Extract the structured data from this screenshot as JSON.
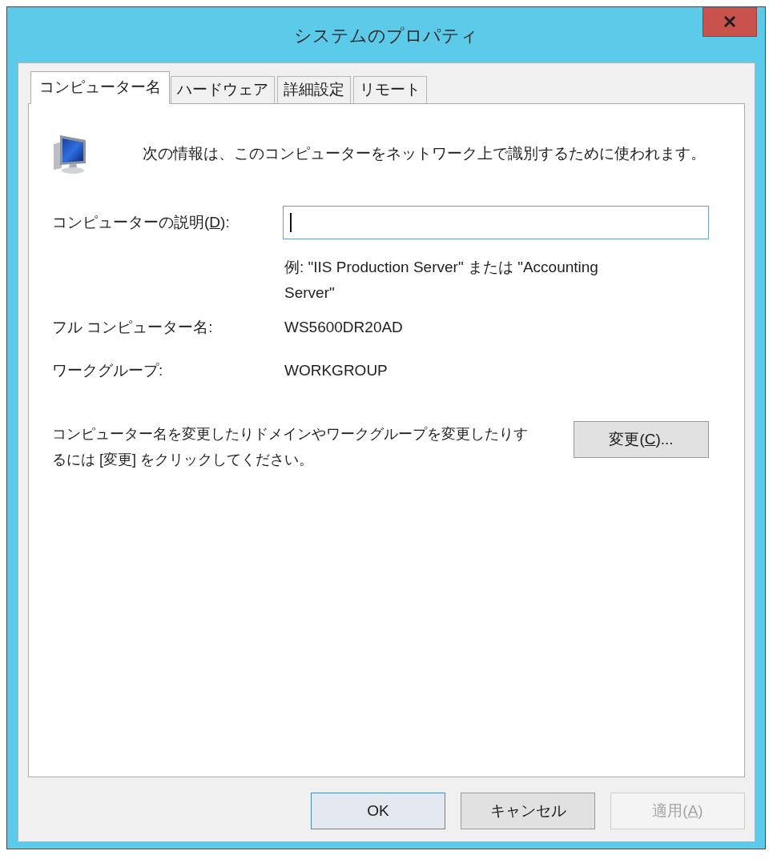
{
  "window": {
    "title": "システムのプロパティ"
  },
  "tabs": [
    {
      "label": "コンピューター名",
      "selected": true
    },
    {
      "label": "ハードウェア",
      "selected": false
    },
    {
      "label": "詳細設定",
      "selected": false
    },
    {
      "label": "リモート",
      "selected": false
    }
  ],
  "intro": "次の情報は、このコンピューターをネットワーク上で識別するために使われます。",
  "description_field": {
    "label": {
      "before": "コンピューターの説明(",
      "key": "D",
      "after": "):"
    },
    "focused": true,
    "hint": "例: \"IIS Production Server\" または \"Accounting Server\""
  },
  "info_rows": [
    {
      "label": "フル コンピューター名:",
      "value": "WS5600DR20AD"
    },
    {
      "label": "ワークグループ:",
      "value": "WORKGROUP"
    }
  ],
  "rename": {
    "text": "コンピューター名を変更したりドメインやワークグループを変更したりするには [変更] をクリックしてください。",
    "button": {
      "before": "変更(",
      "key": "C",
      "after": ")..."
    }
  },
  "buttons": [
    {
      "label": {
        "before": "OK"
      },
      "default": true,
      "disabled": false
    },
    {
      "label": {
        "before": "キャンセル"
      },
      "default": false,
      "disabled": false
    },
    {
      "label": {
        "before": "適用(",
        "key": "A",
        "after": ")"
      },
      "default": false,
      "disabled": true
    }
  ]
}
